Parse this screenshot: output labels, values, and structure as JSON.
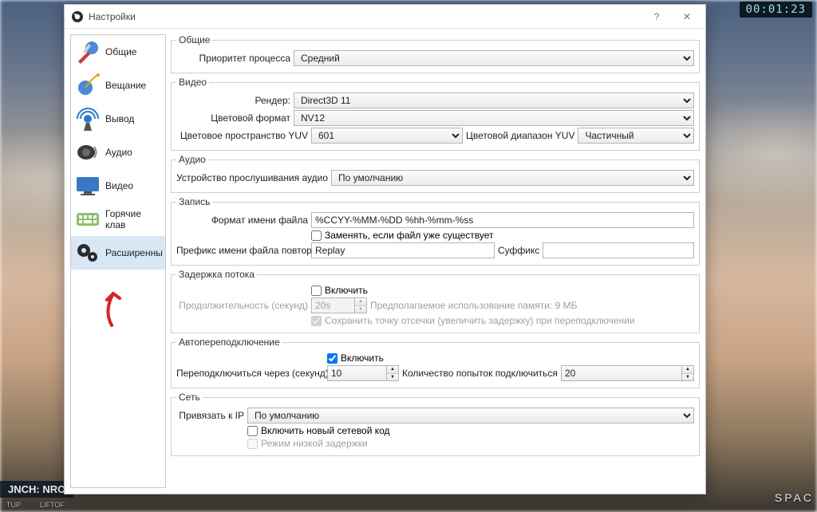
{
  "window": {
    "title": "Настройки",
    "help": "?",
    "close": "✕"
  },
  "hud": {
    "timer": "00:01:23",
    "bl": "JNCH: NRO",
    "bl2": "TUP",
    "bl3": "LIFTOF",
    "br": "SPAC"
  },
  "sidebar": {
    "items": [
      {
        "label": "Общие"
      },
      {
        "label": "Вещание"
      },
      {
        "label": "Вывод"
      },
      {
        "label": "Аудио"
      },
      {
        "label": "Видео"
      },
      {
        "label": "Горячие клав"
      },
      {
        "label": "Расширенны"
      }
    ]
  },
  "groups": {
    "general": {
      "legend": "Общие",
      "priority_label": "Приоритет процесса",
      "priority_value": "Средний"
    },
    "video": {
      "legend": "Видео",
      "render_label": "Рендер:",
      "render_value": "Direct3D 11",
      "colorfmt_label": "Цветовой формат",
      "colorfmt_value": "NV12",
      "colorspace_label": "Цветовое пространство YUV",
      "colorspace_value": "601",
      "colorrange_label": "Цветовой диапазон YUV",
      "colorrange_value": "Частичный"
    },
    "audio": {
      "legend": "Аудио",
      "monitor_label": "Устройство прослушивания аудио",
      "monitor_value": "По умолчанию"
    },
    "record": {
      "legend": "Запись",
      "filename_label": "Формат имени файла",
      "filename_value": "%CCYY-%MM-%DD %hh-%mm-%ss",
      "overwrite_label": "Заменять, если файл уже существует",
      "replay_prefix_label": "Префикс имени файла повтора",
      "replay_prefix_value": "Replay",
      "replay_suffix_label": "Суффикс",
      "replay_suffix_value": ""
    },
    "delay": {
      "legend": "Задержка потока",
      "enable_label": "Включить",
      "duration_label": "Продолжительность (секунд)",
      "duration_value": "20s",
      "mem_label": "Предполагаемое использование памяти: 9 МБ",
      "preserve_label": "Сохранить точку отсечки (увеличить задержку) при переподключении"
    },
    "reconnect": {
      "legend": "Автопереподключение",
      "enable_label": "Включить",
      "retry_label": "Переподключиться через (секунд)",
      "retry_value": "10",
      "maxretry_label": "Количество попыток подключиться",
      "maxretry_value": "20"
    },
    "network": {
      "legend": "Сеть",
      "bind_label": "Привязать к IP",
      "bind_value": "По умолчанию",
      "newcode_label": "Включить новый сетевой код",
      "lowlat_label": "Режим низкой задержки"
    }
  }
}
